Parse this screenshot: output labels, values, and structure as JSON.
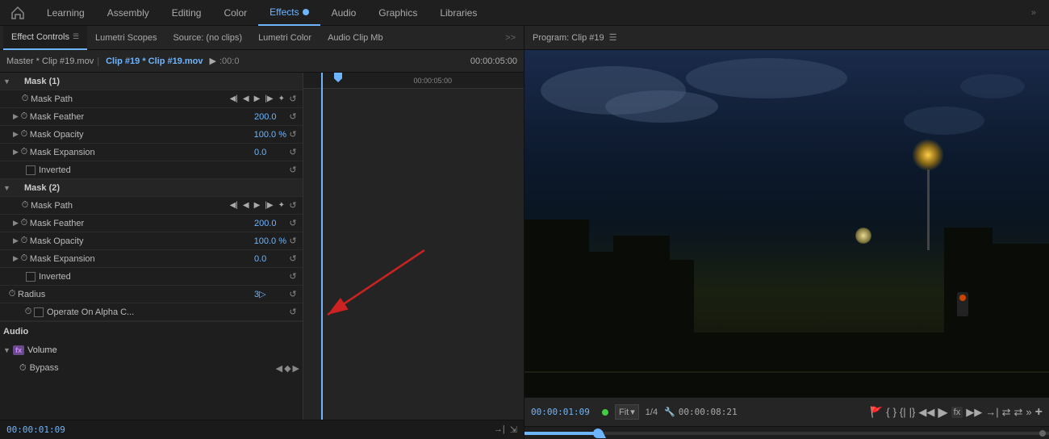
{
  "topNav": {
    "items": [
      {
        "label": "Learning",
        "active": false
      },
      {
        "label": "Assembly",
        "active": false
      },
      {
        "label": "Editing",
        "active": false
      },
      {
        "label": "Color",
        "active": false
      },
      {
        "label": "Effects",
        "active": true
      },
      {
        "label": "Audio",
        "active": false
      },
      {
        "label": "Graphics",
        "active": false
      },
      {
        "label": "Libraries",
        "active": false
      }
    ],
    "chevron": "»"
  },
  "leftPanel": {
    "tabs": [
      {
        "label": "Effect Controls",
        "active": true,
        "hasMenu": true
      },
      {
        "label": "Lumetri Scopes",
        "active": false
      },
      {
        "label": "Source: (no clips)",
        "active": false
      },
      {
        "label": "Lumetri Color",
        "active": false
      },
      {
        "label": "Audio Clip Mb",
        "active": false
      }
    ],
    "chevron": ">>"
  },
  "timelineHeader": {
    "masterLabel": "Master * Clip #19.mov",
    "clipLabel": "Clip #19 * Clip #19.mov",
    "time1": ":00:0",
    "time2": "00:00:05:00"
  },
  "effectControls": {
    "mask1": {
      "label": "Mask (1)",
      "path": {
        "label": "Mask Path",
        "controls": [
          "◀◀",
          "◀",
          "▶",
          "▶▶",
          "✦"
        ]
      },
      "feather": {
        "label": "Mask Feather",
        "value": "200.0"
      },
      "opacity": {
        "label": "Mask Opacity",
        "value": "100.0 %"
      },
      "expansion": {
        "label": "Mask Expansion",
        "value": "0.0"
      },
      "inverted": {
        "label": "Inverted"
      }
    },
    "mask2": {
      "label": "Mask (2)",
      "path": {
        "label": "Mask Path",
        "controls": [
          "◀◀",
          "◀",
          "▶",
          "▶▶",
          "✦"
        ]
      },
      "feather": {
        "label": "Mask Feather",
        "value": "200.0"
      },
      "opacity": {
        "label": "Mask Opacity",
        "value": "100.0 %"
      },
      "expansion": {
        "label": "Mask Expansion",
        "value": "0.0"
      },
      "inverted": {
        "label": "Inverted"
      }
    },
    "radius": {
      "label": "Radius",
      "value": "3▷"
    },
    "operateAlpha": {
      "label": "Operate On Alpha C..."
    },
    "audio": {
      "sectionLabel": "Audio",
      "volume": {
        "fxLabel": "fx",
        "label": "Volume"
      },
      "bypass": {
        "label": "Bypass"
      }
    }
  },
  "bottomBar": {
    "timecode": "00:00:01:09",
    "icons": [
      "→|",
      "⇲"
    ]
  },
  "rightPanel": {
    "header": "Program: Clip #19",
    "playback": {
      "timecode": "00:00:01:09",
      "fit": "Fit",
      "fraction": "1/4",
      "endTimecode": "00:00:08:21"
    },
    "controls": [
      "🚩",
      "{",
      "}",
      "{|",
      "|}",
      "◀◀",
      "▶",
      "fx",
      "▶▶",
      "→|",
      "⇄",
      "⇄",
      "»",
      "+"
    ]
  }
}
